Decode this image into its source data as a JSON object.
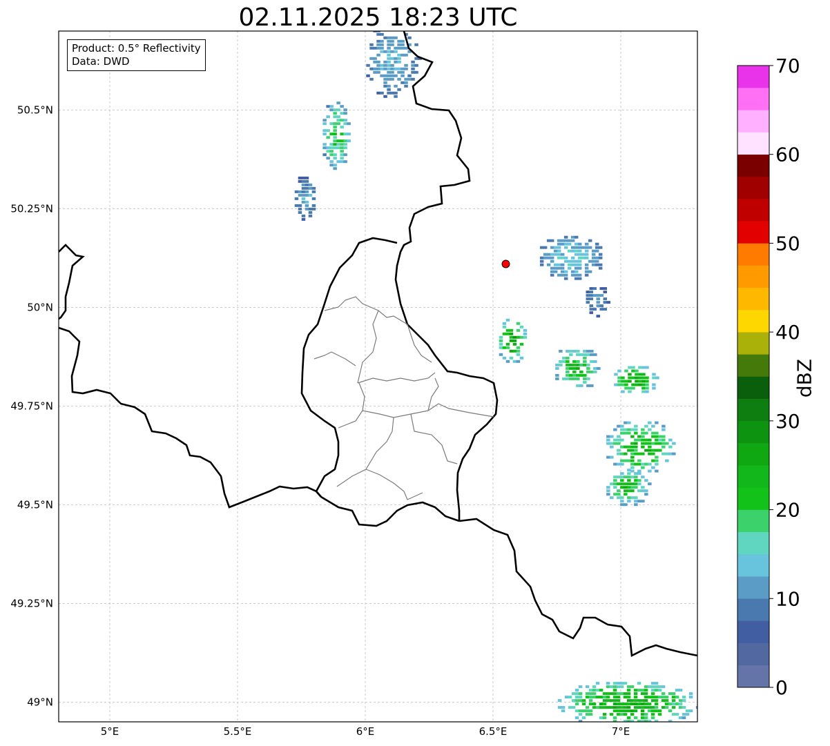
{
  "title": "02.11.2025 18:23 UTC",
  "info": {
    "product": "Product: 0.5° Reflectivity",
    "data": "Data: DWD"
  },
  "map": {
    "lon_range": [
      4.8,
      7.3
    ],
    "lat_range": [
      48.95,
      50.7
    ],
    "lon_ticks": [
      {
        "value": 5.0,
        "label": "5°E"
      },
      {
        "value": 5.5,
        "label": "5.5°E"
      },
      {
        "value": 6.0,
        "label": "6°E"
      },
      {
        "value": 6.5,
        "label": "6.5°E"
      },
      {
        "value": 7.0,
        "label": "7°E"
      }
    ],
    "lat_ticks": [
      {
        "value": 49.0,
        "label": "49°N"
      },
      {
        "value": 49.25,
        "label": "49.25°N"
      },
      {
        "value": 49.5,
        "label": "49.5°N"
      },
      {
        "value": 49.75,
        "label": "49.75°N"
      },
      {
        "value": 50.0,
        "label": "50°N"
      },
      {
        "value": 50.25,
        "label": "50.25°N"
      },
      {
        "value": 50.5,
        "label": "50.5°N"
      }
    ],
    "grid": true,
    "radar_site": {
      "lon": 6.55,
      "lat": 50.11,
      "color": "#ff0000"
    }
  },
  "colorbar": {
    "label": "dBZ",
    "min": 0,
    "max": 70,
    "step": 2.5,
    "tick_labels": [
      "0",
      "10",
      "20",
      "30",
      "40",
      "50",
      "60",
      "70"
    ],
    "colors": [
      "#6473a8",
      "#5168a0",
      "#425ea3",
      "#4a79b0",
      "#5b9cc6",
      "#68c3dc",
      "#60d6c0",
      "#3bd16b",
      "#12c218",
      "#12b81b",
      "#10a812",
      "#0e9310",
      "#0d7e0f",
      "#0a5f0d",
      "#447a0a",
      "#aab20a",
      "#ffd700",
      "#ffb800",
      "#ff9a00",
      "#ff7b00",
      "#e30000",
      "#c00000",
      "#a00000",
      "#7a0000",
      "#ffe2ff",
      "#ffb0ff",
      "#ff70f4",
      "#e833ea"
    ]
  },
  "echoes": [
    {
      "lon": 6.1,
      "lat": 50.63,
      "rx": 0.11,
      "ry": 0.1,
      "dbz": 7,
      "core": 14
    },
    {
      "lon": 5.88,
      "lat": 50.44,
      "rx": 0.06,
      "ry": 0.09,
      "dbz": 9,
      "core": 23
    },
    {
      "lon": 5.76,
      "lat": 50.28,
      "rx": 0.05,
      "ry": 0.06,
      "dbz": 6,
      "core": 13
    },
    {
      "lon": 6.8,
      "lat": 50.13,
      "rx": 0.13,
      "ry": 0.06,
      "dbz": 8,
      "core": 16
    },
    {
      "lon": 6.57,
      "lat": 49.92,
      "rx": 0.06,
      "ry": 0.06,
      "dbz": 11,
      "core": 28
    },
    {
      "lon": 6.82,
      "lat": 49.85,
      "rx": 0.09,
      "ry": 0.06,
      "dbz": 10,
      "core": 24
    },
    {
      "lon": 7.05,
      "lat": 49.82,
      "rx": 0.09,
      "ry": 0.04,
      "dbz": 12,
      "core": 27
    },
    {
      "lon": 7.07,
      "lat": 49.65,
      "rx": 0.14,
      "ry": 0.07,
      "dbz": 11,
      "core": 26
    },
    {
      "lon": 7.02,
      "lat": 49.55,
      "rx": 0.09,
      "ry": 0.05,
      "dbz": 10,
      "core": 24
    },
    {
      "lon": 6.9,
      "lat": 50.02,
      "rx": 0.05,
      "ry": 0.04,
      "dbz": 6,
      "core": 12
    },
    {
      "lon": 7.02,
      "lat": 49.0,
      "rx": 0.28,
      "ry": 0.06,
      "dbz": 12,
      "core": 27
    }
  ]
}
